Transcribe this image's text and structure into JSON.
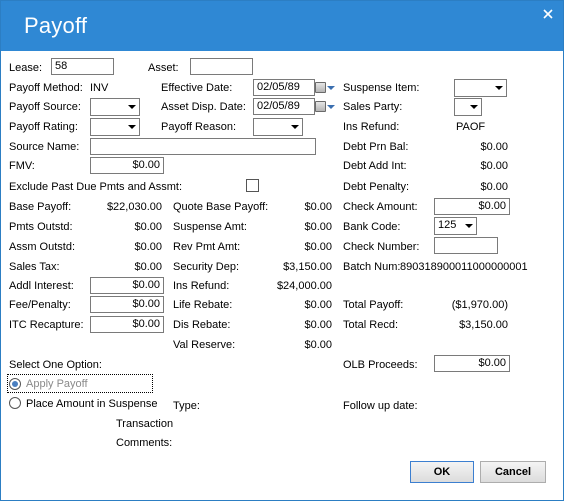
{
  "title": "Payoff",
  "labels": {
    "lease": "Lease:",
    "asset": "Asset:",
    "payoff_method": "Payoff Method:",
    "effective_date": "Effective Date:",
    "suspense_item": "Suspense Item:",
    "payoff_source": "Payoff Source:",
    "asset_disp_date": "Asset Disp. Date:",
    "sales_party": "Sales Party:",
    "payoff_rating": "Payoff Rating:",
    "payoff_reason": "Payoff Reason:",
    "ins_refund_top": "Ins Refund:",
    "source_name": "Source Name:",
    "debt_prn_bal": "Debt Prn Bal:",
    "fmv": "FMV:",
    "debt_add_int": "Debt Add Int:",
    "exclude_past_due": "Exclude Past Due Pmts and Assmt:",
    "debt_penalty": "Debt Penalty:",
    "base_payoff": "Base Payoff:",
    "quote_base_payoff": "Quote Base Payoff:",
    "check_amount": "Check Amount:",
    "pmts_outstd": "Pmts Outstd:",
    "suspense_amt": "Suspense Amt:",
    "bank_code": "Bank Code:",
    "assm_outstd": "Assm Outstd:",
    "rev_pmt_amt": "Rev Pmt Amt:",
    "check_number": "Check Number:",
    "sales_tax": "Sales Tax:",
    "security_dep": "Security Dep:",
    "batch_num": "Batch Num:",
    "addl_interest": "Addl Interest:",
    "ins_refund": "Ins Refund:",
    "fee_penalty": "Fee/Penalty:",
    "life_rebate": "Life Rebate:",
    "total_payoff": "Total Payoff:",
    "itc_recapture": "ITC Recapture:",
    "dis_rebate": "Dis Rebate:",
    "total_recd": "Total Recd:",
    "val_reserve": "Val Reserve:",
    "select_one_option": "Select One Option:",
    "olb_proceeds": "OLB Proceeds:",
    "type": "Type:",
    "follow_up_date": "Follow up date:",
    "transaction": "Transaction",
    "comments": "Comments:"
  },
  "values": {
    "lease": "58",
    "asset": "",
    "payoff_method": "INV",
    "effective_date": "02/05/89",
    "asset_disp_date": "02/05/89",
    "ins_refund_top": "PAOF",
    "source_name": "",
    "debt_prn_bal": "$0.00",
    "fmv": "$0.00",
    "debt_add_int": "$0.00",
    "debt_penalty": "$0.00",
    "base_payoff": "$22,030.00",
    "quote_base_payoff": "$0.00",
    "check_amount": "$0.00",
    "pmts_outstd": "$0.00",
    "suspense_amt": "$0.00",
    "bank_code": "125",
    "assm_outstd": "$0.00",
    "rev_pmt_amt": "$0.00",
    "check_number": "",
    "sales_tax": "$0.00",
    "security_dep": "$3,150.00",
    "batch_num": "890318900011000000001",
    "addl_interest": "$0.00",
    "ins_refund": "$24,000.00",
    "fee_penalty": "$0.00",
    "life_rebate": "$0.00",
    "total_payoff": "($1,970.00)",
    "itc_recapture": "$0.00",
    "dis_rebate": "$0.00",
    "total_recd": "$3,150.00",
    "val_reserve": "$0.00",
    "olb_proceeds": "$0.00"
  },
  "options": {
    "apply_payoff": "Apply Payoff",
    "place_amount_in_suspense": "Place Amount in Suspense"
  },
  "buttons": {
    "ok": "OK",
    "cancel": "Cancel"
  },
  "icons": {
    "close": "close-icon",
    "calendar": "calendar-icon",
    "dropdown": "chevron-down-icon"
  },
  "colors": {
    "titlebar": "#2f88d4",
    "window_border": "#2c7ec3"
  }
}
